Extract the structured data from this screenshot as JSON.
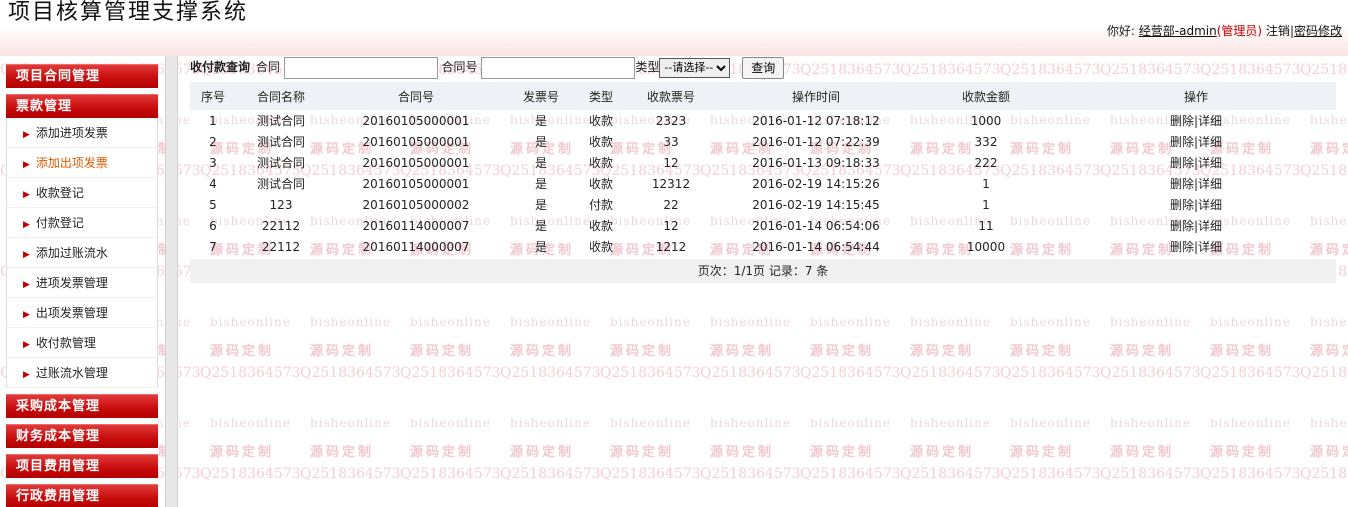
{
  "header": {
    "title": "项目核算管理支撑系统",
    "greeting": "你好:",
    "user": "经营部-admin",
    "role": "(管理员)",
    "logout": "注销",
    "divider": "|",
    "change_password": "密码修改"
  },
  "sidebar": {
    "groups_top": [
      {
        "label": "项目合同管理"
      },
      {
        "label": "票款管理"
      }
    ],
    "items": [
      {
        "label": "添加进项发票",
        "active": false
      },
      {
        "label": "添加出项发票",
        "active": true
      },
      {
        "label": "收款登记",
        "active": false
      },
      {
        "label": "付款登记",
        "active": false
      },
      {
        "label": "添加过账流水",
        "active": false
      },
      {
        "label": "进项发票管理",
        "active": false
      },
      {
        "label": "出项发票管理",
        "active": false
      },
      {
        "label": "收付款管理",
        "active": false
      },
      {
        "label": "过账流水管理",
        "active": false
      }
    ],
    "groups_bottom": [
      {
        "label": "采购成本管理"
      },
      {
        "label": "财务成本管理"
      },
      {
        "label": "项目费用管理"
      },
      {
        "label": "行政费用管理"
      }
    ]
  },
  "search": {
    "title": "收付款查询",
    "contract_label": "合同",
    "contract_value": "",
    "contract_no_label": "合同号",
    "contract_no_value": "",
    "type_label": "类型",
    "type_selected": "--请选择--",
    "query_button": "查询"
  },
  "table": {
    "columns": [
      "序号",
      "合同名称",
      "合同号",
      "发票号",
      "类型",
      "收款票号",
      "操作时间",
      "收款金额",
      "操作"
    ],
    "rows": [
      [
        "1",
        "测试合同",
        "20160105000001",
        "是",
        "收款",
        "2323",
        "2016-01-12 07:18:12",
        "1000",
        "删除|详细"
      ],
      [
        "2",
        "测试合同",
        "20160105000001",
        "是",
        "收款",
        "33",
        "2016-01-12 07:22:39",
        "332",
        "删除|详细"
      ],
      [
        "3",
        "测试合同",
        "20160105000001",
        "是",
        "收款",
        "12",
        "2016-01-13 09:18:33",
        "222",
        "删除|详细"
      ],
      [
        "4",
        "测试合同",
        "20160105000001",
        "是",
        "收款",
        "12312",
        "2016-02-19 14:15:26",
        "1",
        "删除|详细"
      ],
      [
        "5",
        "123",
        "20160105000002",
        "是",
        "付款",
        "22",
        "2016-02-19 14:15:45",
        "1",
        "删除|详细"
      ],
      [
        "6",
        "22112",
        "20160114000007",
        "是",
        "收款",
        "12",
        "2016-01-14 06:54:06",
        "11",
        "删除|详细"
      ],
      [
        "7",
        "22112",
        "20160114000007",
        "是",
        "收款",
        "1212",
        "2016-01-14 06:54:44",
        "10000",
        "删除|详细"
      ]
    ],
    "pager": "页次：1/1页 记录：7 条"
  },
  "watermark": {
    "line_a": "bisheonline",
    "line_b": "源码定制",
    "line_c": "Q2518364573"
  },
  "colors": {
    "menu_red": "#c90d0d",
    "active_item": "#e05a00",
    "role_text": "#c40000",
    "header_band": "#fbe3e3"
  }
}
